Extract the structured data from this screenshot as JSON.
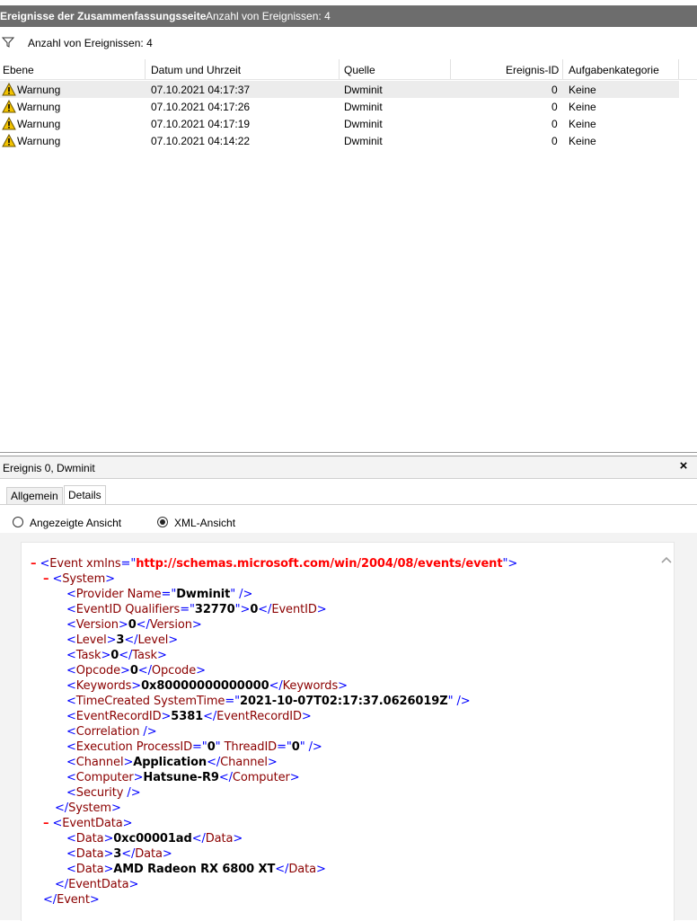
{
  "header": {
    "title": "Ereignisse der Zusammenfassungsseite",
    "count_text": "Anzahl von Ereignissen: 4"
  },
  "filter": {
    "icon": "filter-icon",
    "text": "Anzahl von Ereignissen: 4"
  },
  "grid": {
    "columns": [
      "Ebene",
      "Datum und Uhrzeit",
      "Quelle",
      "Ereignis-ID",
      "Aufgabenkategorie"
    ],
    "rows": [
      {
        "level": "Warnung",
        "datetime": "07.10.2021 04:17:37",
        "source": "Dwminit",
        "event_id": "0",
        "category": "Keine",
        "selected": true
      },
      {
        "level": "Warnung",
        "datetime": "07.10.2021 04:17:26",
        "source": "Dwminit",
        "event_id": "0",
        "category": "Keine"
      },
      {
        "level": "Warnung",
        "datetime": "07.10.2021 04:17:19",
        "source": "Dwminit",
        "event_id": "0",
        "category": "Keine"
      },
      {
        "level": "Warnung",
        "datetime": "07.10.2021 04:14:22",
        "source": "Dwminit",
        "event_id": "0",
        "category": "Keine"
      }
    ]
  },
  "details": {
    "title": "Ereignis 0, Dwminit",
    "close": "×",
    "tabs": [
      "Allgemein",
      "Details"
    ],
    "active_tab": "Details",
    "radio_friendly": "Angezeigte Ansicht",
    "radio_xml": "XML-Ansicht",
    "selected_view": "XML-Ansicht"
  },
  "xml": {
    "minus": "–",
    "event_tag": "Event",
    "xmlns_attr": "xmlns",
    "xmlns_value": "http://schemas.microsoft.com/win/2004/08/events/event",
    "system_tag": "System",
    "provider_name": "Dwminit",
    "qualifiers": "32770",
    "event_id": "0",
    "version": "0",
    "level": "3",
    "task": "0",
    "opcode": "0",
    "keywords": "0x80000000000000",
    "system_time": "2021-10-07T02:17:37.0626019Z",
    "record_id": "5381",
    "process_id": "0",
    "thread_id": "0",
    "channel": "Application",
    "computer": "Hatsune-R9",
    "eventdata_tag": "EventData",
    "data": [
      "0xc00001ad",
      "3",
      "AMD Radeon RX 6800 XT"
    ]
  },
  "colors": {
    "header_bar": "#6d6d6d",
    "selected_row": "#ececec",
    "xml_tag": "#8b0000",
    "xml_bracket": "#0000ff",
    "xml_url": "#ff0000"
  }
}
